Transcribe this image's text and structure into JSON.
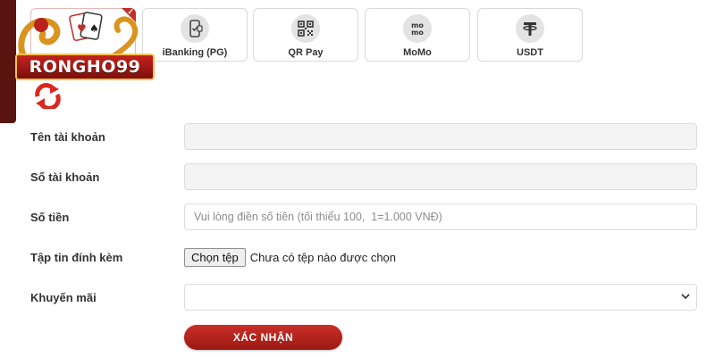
{
  "brand": {
    "logo_text": "RONGHO99",
    "accent_color": "#c0302a",
    "dark_color": "#5a1410"
  },
  "payment_methods": [
    {
      "label": "",
      "icon": "card-icon",
      "selected": true
    },
    {
      "label": "iBanking (PG)",
      "icon": "ibanking-phone-icon",
      "selected": false
    },
    {
      "label": "QR Pay",
      "icon": "qr-code-icon",
      "selected": false
    },
    {
      "label": "MoMo",
      "icon": "momo-icon",
      "selected": false
    },
    {
      "label": "USDT",
      "icon": "tether-icon",
      "selected": false
    }
  ],
  "form": {
    "account_name_label": "Tên tài khoản",
    "account_name_value": "",
    "account_number_label": "Số tài khoản",
    "account_number_value": "",
    "amount_label": "Số tiền",
    "amount_placeholder": "Vui lòng điền số tiền (tối thiểu 100,  1=1.000 VNĐ)",
    "attachment_label": "Tập tin đính kèm",
    "file_button_label": "Chọn tệp",
    "file_status": "Chưa có tệp nào được chọn",
    "promotion_label": "Khuyến mãi",
    "promotion_value": "",
    "submit_label": "XÁC NHẬN"
  }
}
